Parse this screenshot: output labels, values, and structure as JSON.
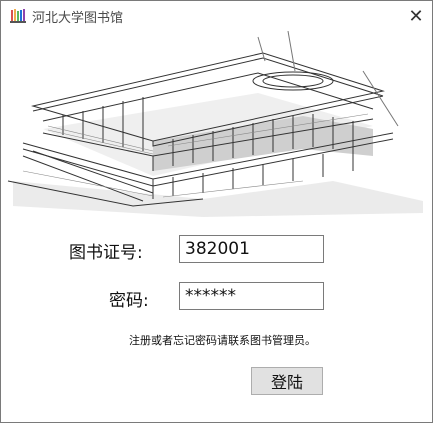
{
  "window": {
    "title": "河北大学图书馆",
    "close_glyph": "✕"
  },
  "form": {
    "card_label": "图书证号:",
    "card_value": "382001",
    "password_label": "密码:",
    "password_value": "******",
    "hint": "注册或者忘记密码请联系图书管理员。",
    "login_label": "登陆"
  },
  "icons": {
    "app": "books-icon",
    "close": "close-icon"
  },
  "colors": {
    "accent": "#1e73d8",
    "button_bg": "#e1e1e1",
    "border": "#7a7a7a"
  }
}
